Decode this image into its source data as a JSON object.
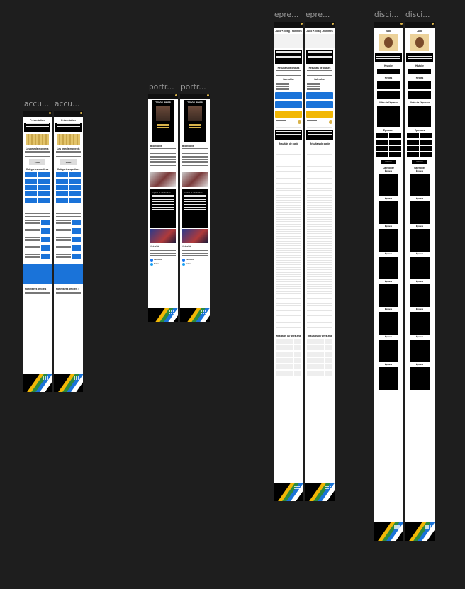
{
  "canvas": {
    "background": "#1e1e1e",
    "label_color": "#9a9a9a"
  },
  "frame_labels": [
    "accu...",
    "accu...",
    "portr...",
    "portr...",
    "epre...",
    "epre...",
    "disci...",
    "disci..."
  ],
  "accueil": {
    "title": "Présentation",
    "section_heading": "Les grands moments",
    "button_label": "Visiter",
    "categories_heading": "Catégories sportives",
    "partners_heading": "Partenaires officiels :",
    "accent": "#1a73d9"
  },
  "portrait": {
    "name": "TEDDY RINER",
    "bio_heading": "Biographie",
    "panel_heading": "Exploit et distinction",
    "second_heading": "Actualité",
    "social": [
      "Facebook",
      "Twitter"
    ]
  },
  "epreuve": {
    "title": "Judo +100kg - hommes",
    "results_heading": "Résultats de phases",
    "results_heading_2": "Résultats de poule",
    "calendar_heading": "Calendrier",
    "last_heading": "Résultats du week-end",
    "colors": {
      "blue": "#1a73d9",
      "yellow": "#f2b705",
      "gold": "#d8b24a"
    }
  },
  "discipline": {
    "title": "Judo",
    "section_1": "Histoire",
    "section_2": "Règles",
    "section_3": "Vidéo de l'épreuve",
    "section_4": "Épreuves",
    "section_5": "Calendrier",
    "more_label": "Voir tout",
    "event_label": "Épreuve"
  }
}
